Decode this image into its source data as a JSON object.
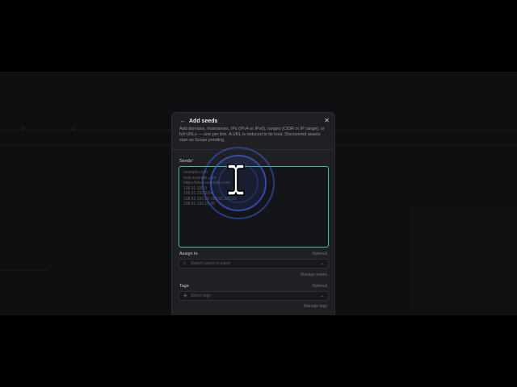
{
  "modal": {
    "back_label": "←",
    "title": "Add seeds",
    "close_label": "✕",
    "description": "Add domains, hostnames, IPs (IPv4 or IPv6), ranges (CIDR or IP range), or full URLs — one per line. A URL is reduced to its host. Discovered assets start as Scope pending.",
    "seeds": {
      "label": "Seeds",
      "required_mark": "*",
      "placeholder": "example.com\nmail.example.com\nhttps://shop.example.com/\n198.51.100.5\n198.51.100.0/24\n198.51.100.10-198.51.100.20\n198.51.100.10-20"
    },
    "assign": {
      "label": "Assign to",
      "optional": "Optional",
      "placeholder": "Search users or users",
      "manage": "Manage teams"
    },
    "tags": {
      "label": "Tags",
      "optional": "Optional",
      "placeholder": "Select tags",
      "manage": "Manage tags"
    }
  },
  "colors": {
    "accent": "#3fbf9a",
    "modal_bg": "#1f2024",
    "page_bg": "#17181b",
    "cursor_ring": "#3a5bd8"
  },
  "cursor": {
    "icon": "text-cursor-icon"
  }
}
